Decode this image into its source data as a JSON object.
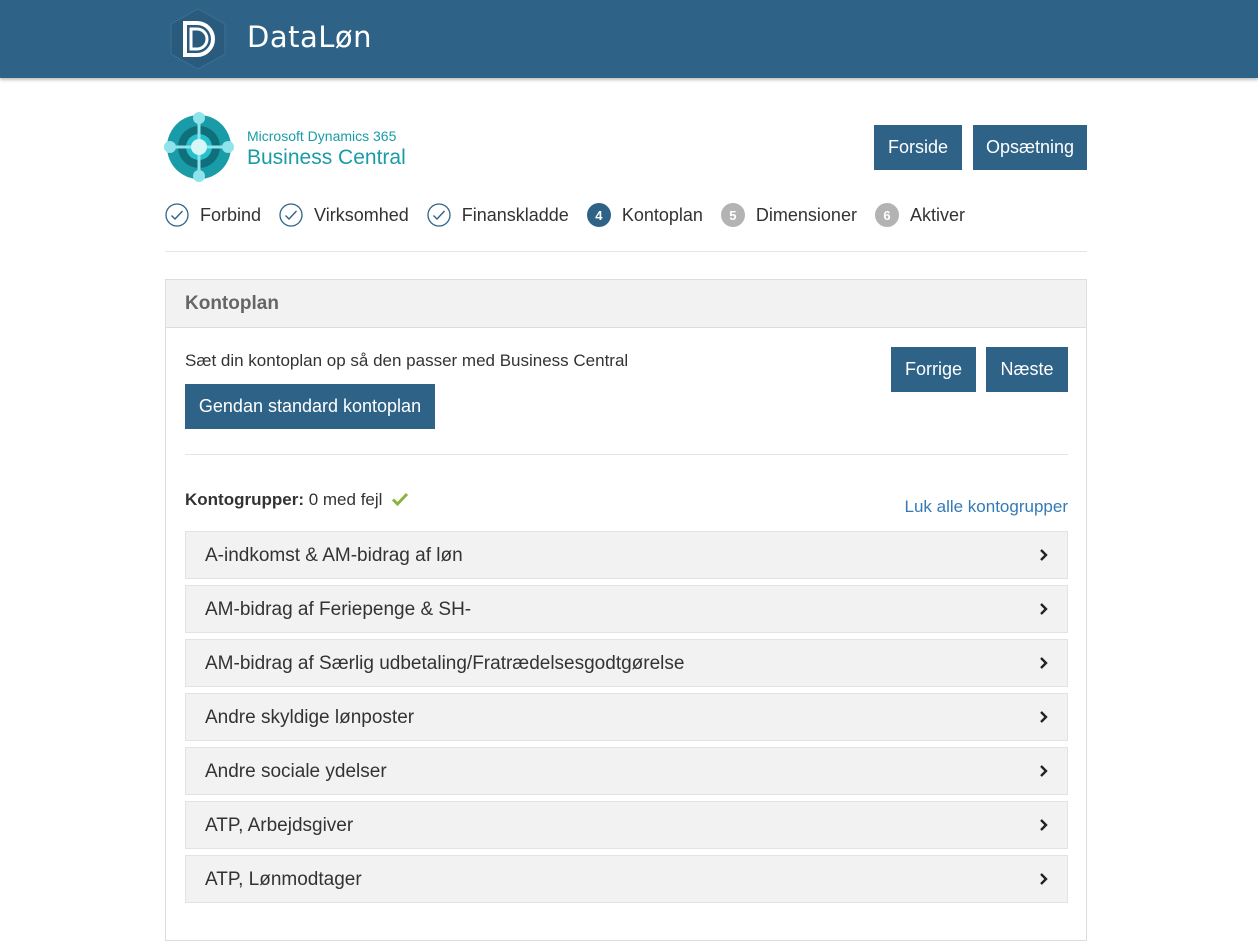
{
  "header": {
    "brand": "DataLøn"
  },
  "product": {
    "subtitle": "Microsoft Dynamics 365",
    "title": "Business Central"
  },
  "nav": {
    "home_label": "Forside",
    "setup_label": "Opsætning"
  },
  "steps": [
    {
      "label": "Forbind",
      "state": "done"
    },
    {
      "label": "Virksomhed",
      "state": "done"
    },
    {
      "label": "Finanskladde",
      "state": "done"
    },
    {
      "number": "4",
      "label": "Kontoplan",
      "state": "active"
    },
    {
      "number": "5",
      "label": "Dimensioner",
      "state": "pending"
    },
    {
      "number": "6",
      "label": "Aktiver",
      "state": "pending"
    }
  ],
  "panel": {
    "title": "Kontoplan",
    "description": "Sæt din kontoplan op så den passer med Business Central",
    "restore_label": "Gendan standard kontoplan",
    "prev_label": "Forrige",
    "next_label": "Næste",
    "groups_label": "Kontogrupper:",
    "groups_status": "0 med fejl",
    "collapse_all_label": "Luk alle kontogrupper",
    "groups": [
      "A-indkomst & AM-bidrag af løn",
      "AM-bidrag af Feriepenge & SH-",
      "AM-bidrag af Særlig udbetaling/Fratrædelsesgodtgørelse",
      "Andre skyldige lønposter",
      "Andre sociale ydelser",
      "ATP, Arbejdsgiver",
      "ATP, Lønmodtager"
    ]
  },
  "colors": {
    "primary": "#2e6387",
    "accent_teal": "#1a9ba8",
    "success": "#8ab53b",
    "link": "#337ab7"
  }
}
